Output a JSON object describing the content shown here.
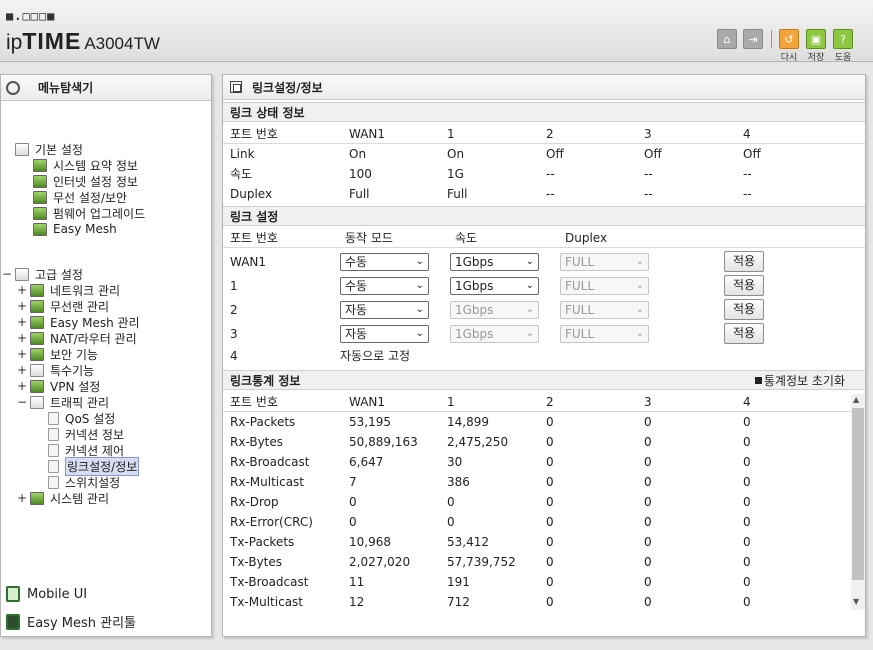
{
  "header": {
    "logo_dots": "■.□□□■",
    "brand_ip": "ip",
    "brand_time": "TIME",
    "model": "A3004TW",
    "buttons": [
      {
        "label": "",
        "icon": "home-icon"
      },
      {
        "label": "",
        "icon": "logout-icon"
      },
      {
        "label": "다시",
        "icon": "reload-icon"
      },
      {
        "label": "저장",
        "icon": "save-icon"
      },
      {
        "label": "도움",
        "icon": "help-icon"
      }
    ]
  },
  "sidebar": {
    "title": "메뉴탐색기",
    "basic": {
      "label": "기본 설정",
      "items": [
        "시스템 요약 정보",
        "인터넷 설정 정보",
        "무선 설정/보안",
        "펌웨어 업그레이드",
        "Easy Mesh"
      ]
    },
    "advanced": {
      "label": "고급 설정",
      "items": [
        "네트워크 관리",
        "무선랜 관리",
        "Easy Mesh 관리",
        "NAT/라우터 관리",
        "보안 기능",
        "특수기능",
        "VPN 설정",
        "트래픽 관리"
      ],
      "traffic_sub": [
        "QoS 설정",
        "커넥션 정보",
        "커넥션 제어",
        "링크설정/정보",
        "스위치설정"
      ],
      "last": "시스템 관리"
    },
    "bottom": [
      "Mobile UI",
      "Easy Mesh 관리툴"
    ]
  },
  "main": {
    "title": "링크설정/정보",
    "status": {
      "heading": "링크 상태 정보",
      "header": [
        "포트 번호",
        "WAN1",
        "1",
        "2",
        "3",
        "4"
      ],
      "rows": [
        [
          "Link",
          "On",
          "On",
          "Off",
          "Off",
          "Off"
        ],
        [
          "속도",
          "100",
          "1G",
          "--",
          "--",
          "--"
        ],
        [
          "Duplex",
          "Full",
          "Full",
          "--",
          "--",
          "--"
        ]
      ]
    },
    "config": {
      "heading": "링크 설정",
      "header": [
        "포트 번호",
        "동작 모드",
        "속도",
        "Duplex"
      ],
      "rows": [
        {
          "port": "WAN1",
          "mode": "수동",
          "speed": "1Gbps",
          "duplex": "FULL",
          "apply": "적용"
        },
        {
          "port": "1",
          "mode": "수동",
          "speed": "1Gbps",
          "duplex": "FULL",
          "apply": "적용"
        },
        {
          "port": "2",
          "mode": "자동",
          "speed": "1Gbps",
          "duplex": "FULL",
          "apply": "적용"
        },
        {
          "port": "3",
          "mode": "자동",
          "speed": "1Gbps",
          "duplex": "FULL",
          "apply": "적용"
        }
      ],
      "fixed_port": "4",
      "fixed_text": "자동으로 고정"
    },
    "stats": {
      "heading": "링크통계 정보",
      "reset_label": "통계정보 초기화",
      "header": [
        "포트 번호",
        "WAN1",
        "1",
        "2",
        "3",
        "4"
      ],
      "rows": [
        [
          "Rx-Packets",
          "53,195",
          "14,899",
          "0",
          "0",
          "0"
        ],
        [
          "Rx-Bytes",
          "50,889,163",
          "2,475,250",
          "0",
          "0",
          "0"
        ],
        [
          "Rx-Broadcast",
          "6,647",
          "30",
          "0",
          "0",
          "0"
        ],
        [
          "Rx-Multicast",
          "7",
          "386",
          "0",
          "0",
          "0"
        ],
        [
          "Rx-Drop",
          "0",
          "0",
          "0",
          "0",
          "0"
        ],
        [
          "Rx-Error(CRC)",
          "0",
          "0",
          "0",
          "0",
          "0"
        ],
        [
          "Tx-Packets",
          "10,968",
          "53,412",
          "0",
          "0",
          "0"
        ],
        [
          "Tx-Bytes",
          "2,027,020",
          "57,739,752",
          "0",
          "0",
          "0"
        ],
        [
          "Tx-Broadcast",
          "11",
          "191",
          "0",
          "0",
          "0"
        ],
        [
          "Tx-Multicast",
          "12",
          "712",
          "0",
          "0",
          "0"
        ]
      ]
    }
  }
}
